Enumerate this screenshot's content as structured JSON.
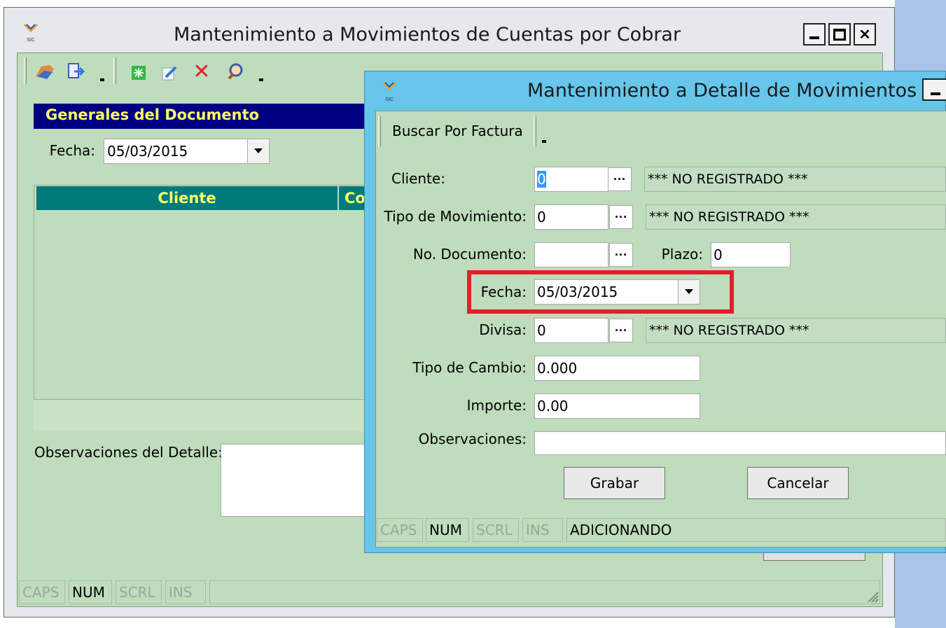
{
  "main_window": {
    "title": "Mantenimiento a Movimientos de Cuentas por Cobrar",
    "section_title": "Generales del Documento",
    "fecha_label": "Fecha:",
    "fecha_value": "05/03/2015",
    "grid_headers": [
      "Cliente",
      "Co"
    ],
    "observaciones_label": "Observaciones del Detalle:",
    "status": {
      "caps": "CAPS",
      "num": "NUM",
      "scrl": "SCRL",
      "ins": "INS"
    }
  },
  "dialog": {
    "title": "Mantenimiento a Detalle de Movimientos",
    "toolbar_button": "Buscar Por Factura",
    "cliente_label": "Cliente:",
    "cliente_value": "0",
    "cliente_desc": "*** NO REGISTRADO ***",
    "tipo_mov_label": "Tipo de Movimiento:",
    "tipo_mov_value": "0",
    "tipo_mov_desc": "*** NO REGISTRADO ***",
    "no_doc_label": "No. Documento:",
    "no_doc_value": "",
    "plazo_label": "Plazo:",
    "plazo_value": "0",
    "fecha_label": "Fecha:",
    "fecha_value": "05/03/2015",
    "divisa_label": "Divisa:",
    "divisa_value": "0",
    "divisa_desc": "*** NO REGISTRADO ***",
    "tipo_cambio_label": "Tipo de Cambio:",
    "tipo_cambio_value": "0.000",
    "importe_label": "Importe:",
    "importe_value": "0.00",
    "observaciones_label": "Observaciones:",
    "observaciones_value": "",
    "grabar_label": "Grabar",
    "cancelar_label": "Cancelar",
    "status": {
      "caps": "CAPS",
      "num": "NUM",
      "scrl": "SCRL",
      "ins": "INS",
      "mode": "ADICIONANDO"
    }
  },
  "colors": {
    "highlight": "#e0202a",
    "section_bg": "#000080",
    "section_text": "#ffff66",
    "grid_header_bg": "#007a7a",
    "dialog_frame": "#67c6ea"
  }
}
